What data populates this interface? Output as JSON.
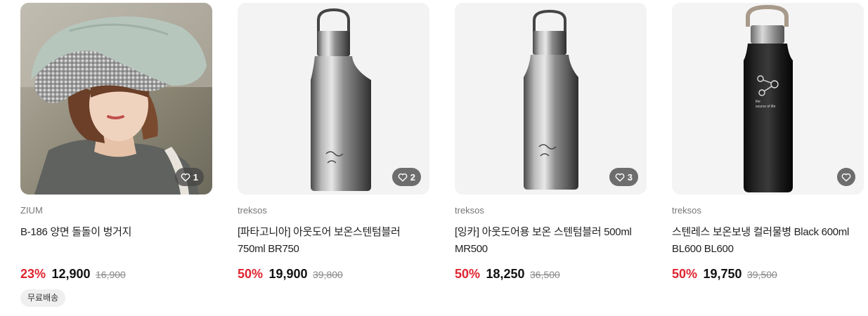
{
  "products": [
    {
      "image_desc": "woman wearing mint bucket hat",
      "likes": "1",
      "brand": "ZIUM",
      "title": "B-186 양면 돌돌이 벙거지",
      "discount": "23%",
      "price": "12,900",
      "original_price": "16,900",
      "tag": "무료배송"
    },
    {
      "image_desc": "silver stainless tumbler 750ml",
      "likes": "2",
      "brand": "treksos",
      "title": "[파타고니아] 아웃도어 보온스텐텀블러 750ml BR750",
      "discount": "50%",
      "price": "19,900",
      "original_price": "39,800"
    },
    {
      "image_desc": "silver stainless tumbler 500ml",
      "likes": "3",
      "brand": "treksos",
      "title": "[잉카] 아웃도어용 보온 스텐텀블러 500ml MR500",
      "discount": "50%",
      "price": "18,250",
      "original_price": "36,500"
    },
    {
      "image_desc": "black insulated bottle 600ml",
      "likes": "",
      "brand": "treksos",
      "title": "스텐레스 보온보냉 컬러물병 Black 600ml BL600 BL600",
      "discount": "50%",
      "price": "19,750",
      "original_price": "39,500",
      "bottle_print": [
        "the",
        "source of life"
      ]
    }
  ],
  "colors": {
    "discount": "#e0242f",
    "like_badge": "#464646"
  },
  "icons": {
    "like": "heart-outline-icon"
  }
}
